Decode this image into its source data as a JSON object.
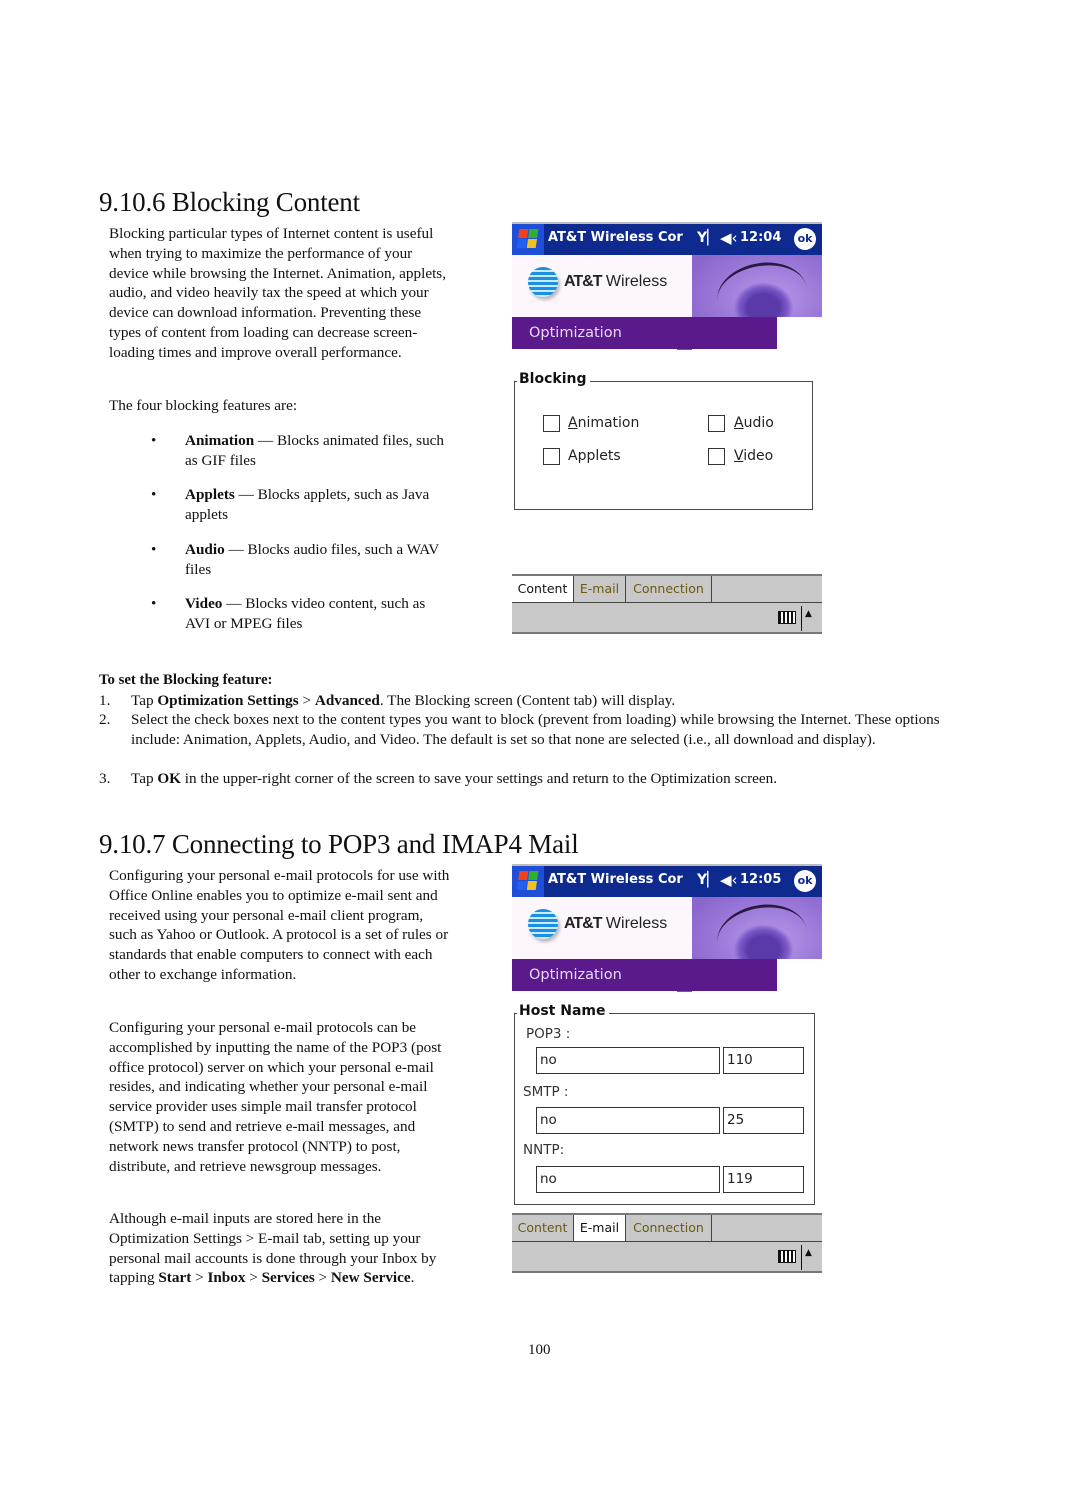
{
  "section1": {
    "heading": "9.10.6  Blocking Content",
    "intro": "Blocking particular types of Internet content is useful when trying to maximize the performance of your device while browsing the Internet. Animation, applets, audio, and video heavily tax the speed at which your device can download information. Preventing these types of content from loading can decrease screen-loading times and improve overall performance.",
    "features_intro": "The four blocking features are:",
    "bullets": [
      {
        "term": "Animation",
        "desc": " — Blocks animated files, such as GIF files"
      },
      {
        "term": "Applets",
        "desc": " — Blocks applets, such as Java applets"
      },
      {
        "term": "Audio",
        "desc": " — Blocks audio files, such a WAV files"
      },
      {
        "term": "Video",
        "desc": " — Blocks video content, such as AVI or MPEG files"
      }
    ],
    "steps_title": "To set the Blocking feature:",
    "steps": [
      {
        "num": "1.",
        "parts": [
          [
            "Tap ",
            false
          ],
          [
            "Optimization Settings",
            true
          ],
          [
            " > ",
            false
          ],
          [
            "Advanced",
            true
          ],
          [
            ". The Blocking screen (Content tab) will display.",
            false
          ]
        ]
      },
      {
        "num": "2.",
        "parts": [
          [
            "Select the check boxes next to the content types you want to block (prevent from loading) while browsing the Internet. These options include: Animation, Applets, Audio, and Video. The default is set so that none are selected (i.e., all download and display).",
            false
          ]
        ]
      },
      {
        "num": "3.",
        "parts": [
          [
            "Tap ",
            false
          ],
          [
            "OK",
            true
          ],
          [
            " in the upper-right corner of the screen to save your settings and return to the Optimization screen.",
            false
          ]
        ]
      }
    ],
    "screen": {
      "title": "AT&T Wireless Cor",
      "time": "12:04",
      "ok": "ok",
      "logo_bold": "AT&T",
      "logo_rest": "Wireless",
      "banner": "Optimization",
      "group": "Blocking",
      "checkboxes": [
        {
          "label": "Animation",
          "mnemonic": "A",
          "rest": "nimation",
          "checked": false
        },
        {
          "label": "Audio",
          "mnemonic": "A",
          "rest": "udio",
          "checked": false
        },
        {
          "label": "Applets",
          "mnemonic": "",
          "rest": "Applets",
          "checked": false
        },
        {
          "label": "Video",
          "mnemonic": "V",
          "rest": "ideo",
          "checked": false
        }
      ],
      "tabs": [
        "Content",
        "E-mail",
        "Connection"
      ],
      "active_tab": "Content"
    }
  },
  "section2": {
    "heading": "9.10.7  Connecting to POP3 and IMAP4 Mail",
    "para1": "Configuring your personal e-mail protocols for use with Office Online enables you to optimize e-mail sent and received using your personal e-mail client program, such as Yahoo or Outlook. A protocol is a set of rules or standards that enable computers to connect with each other to exchange information.",
    "para2": "Configuring your personal e-mail protocols can be accomplished by inputting the name of the POP3 (post office protocol) server on which your personal e-mail resides, and indicating whether your personal e-mail service provider uses simple mail transfer protocol (SMTP) to send and retrieve e-mail messages, and network news transfer protocol (NNTP) to post, distribute, and retrieve newsgroup messages.",
    "para3_parts": [
      [
        "Although e-mail inputs are stored here in the Optimization Settings > E-mail tab, setting up your personal mail accounts is done through your Inbox by tapping ",
        false
      ],
      [
        "Start",
        true
      ],
      [
        " > ",
        false
      ],
      [
        "Inbox",
        true
      ],
      [
        " > ",
        false
      ],
      [
        "Services",
        true
      ],
      [
        " > ",
        false
      ],
      [
        "New Service",
        true
      ],
      [
        ".",
        false
      ]
    ],
    "screen": {
      "title": "AT&T Wireless Cor",
      "time": "12:05",
      "ok": "ok",
      "logo_bold": "AT&T",
      "logo_rest": "Wireless",
      "banner": "Optimization",
      "group": "Host Name",
      "hosts": [
        {
          "label": "POP3 :",
          "host": "no",
          "port": "110"
        },
        {
          "label": "SMTP :",
          "host": "no",
          "port": "25"
        },
        {
          "label": "NNTP:",
          "host": "no",
          "port": "119"
        }
      ],
      "tabs": [
        "Content",
        "E-mail",
        "Connection"
      ],
      "active_tab": "E-mail"
    }
  },
  "page_number": "100",
  "colors": {
    "titlebar": "#0f2a8f",
    "start_button": "#1e4fd6",
    "banner_purple": "#5a1a8c",
    "tab_gray": "#c8c8c8"
  }
}
